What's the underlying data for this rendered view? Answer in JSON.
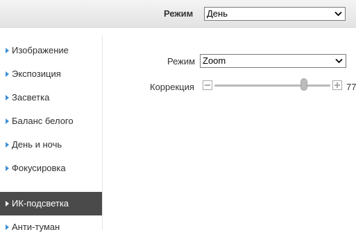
{
  "header": {
    "mode_label": "Режим",
    "mode_value": "День"
  },
  "sidebar": {
    "items": [
      {
        "label": "Изображение",
        "active": false
      },
      {
        "label": "Экспозиция",
        "active": false
      },
      {
        "label": "Засветка",
        "active": false
      },
      {
        "label": "Баланс белого",
        "active": false
      },
      {
        "label": "День и ночь",
        "active": false
      },
      {
        "label": "Фокусировка",
        "active": false
      },
      {
        "label": "ИК-подсветка",
        "active": true
      },
      {
        "label": "Анти-туман",
        "active": false
      }
    ]
  },
  "settings": {
    "mode_label": "Режим",
    "mode_value": "Zoom",
    "correction_label": "Коррекция",
    "correction_value": "77",
    "correction_level": 0.77
  },
  "icons": {
    "select_arrow": "chevron-down-icon",
    "sidebar_bullet": "triangle-right-icon",
    "slider_decrease": "minus-icon",
    "slider_increase": "plus-icon"
  },
  "colors": {
    "accent": "#3d8fd9",
    "active_item_bg": "#4a4a4a"
  }
}
